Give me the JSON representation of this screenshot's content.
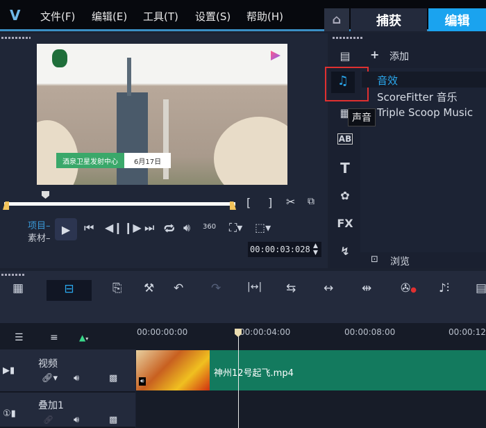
{
  "menu": {
    "logo": "V",
    "items": [
      "文件(F)",
      "编辑(E)",
      "工具(T)",
      "设置(S)",
      "帮助(H)"
    ]
  },
  "tabs": {
    "home": "⌂",
    "capture": "捕获",
    "edit": "编辑"
  },
  "preview": {
    "lower_third": "酒泉卫星发射中心",
    "date": "6月17日",
    "mode_project": "项目–",
    "mode_clip": "素材–",
    "timecode": "00:00:03:028",
    "bracket_in": "[",
    "bracket_out": "]"
  },
  "library": {
    "add": "添加",
    "items": [
      "音效",
      "ScoreFitter 音乐",
      "Triple Scoop Music"
    ],
    "tooltip": "声音",
    "browse": "浏览",
    "side_icons": {
      "ab": "AB",
      "title": "T",
      "fx": "FX"
    }
  },
  "ruler": {
    "ticks": [
      "00:00:00:00",
      "00:00:04:00",
      "00:00:08:00",
      "00:00:12"
    ]
  },
  "tracks": [
    {
      "name": "视频",
      "clip": "神州12号起飞.mp4"
    },
    {
      "name": "叠加1"
    }
  ],
  "colors": {
    "accent": "#1aa3ef",
    "clip": "#137a5e",
    "highlight": "#e03030"
  }
}
